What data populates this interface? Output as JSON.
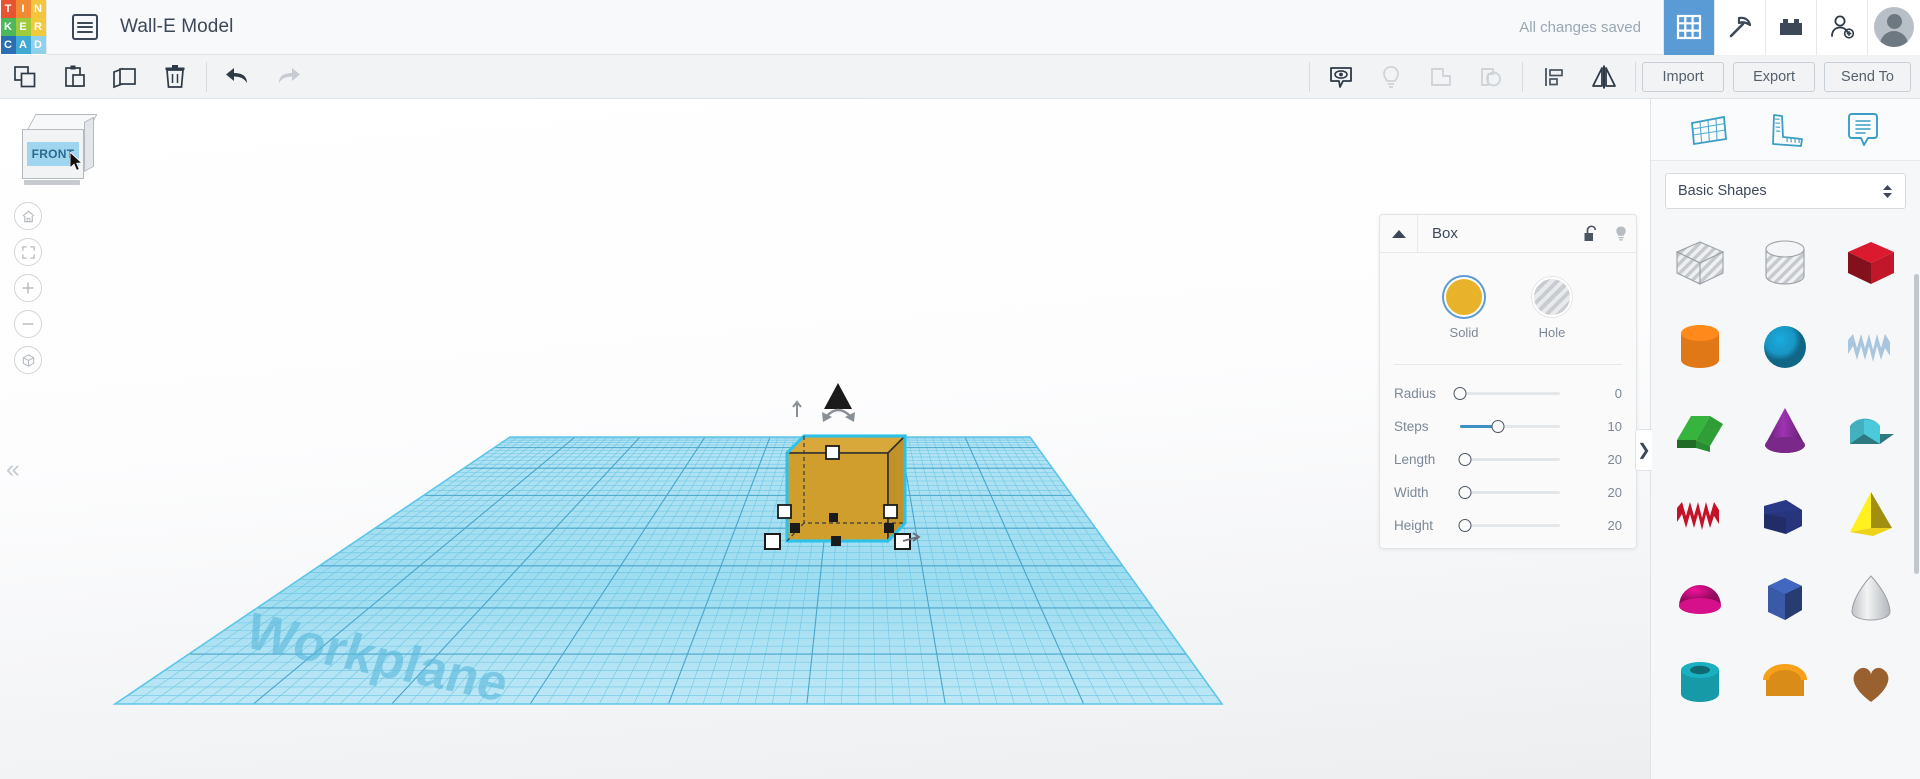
{
  "app": {
    "brand_letters": [
      "T",
      "I",
      "N",
      "K",
      "E",
      "R",
      "C",
      "A",
      "D"
    ],
    "brand_colors": [
      "#e8542f",
      "#f08b33",
      "#f5c53d",
      "#4cb85c",
      "#9dcb3b",
      "#f0c93d",
      "#2b6fb3",
      "#3fa9d4",
      "#8fd0ea"
    ],
    "document_title": "Wall-E Model",
    "save_status": "All changes saved"
  },
  "topbar_icons": [
    {
      "name": "blocks-grid-icon",
      "label": "3D Design",
      "active": true
    },
    {
      "name": "pickaxe-icon",
      "label": "Minecraft",
      "active": false
    },
    {
      "name": "brick-icon",
      "label": "Blocks",
      "active": false
    },
    {
      "name": "invite-person-icon",
      "label": "Invite people",
      "active": false
    }
  ],
  "toolbar": {
    "left_tools": [
      {
        "name": "copy-icon",
        "label": "Copy",
        "enabled": true
      },
      {
        "name": "paste-icon",
        "label": "Paste",
        "enabled": true
      },
      {
        "name": "duplicate-icon",
        "label": "Duplicate",
        "enabled": true
      },
      {
        "name": "delete-icon",
        "label": "Delete",
        "enabled": true
      }
    ],
    "history_tools": [
      {
        "name": "undo-icon",
        "label": "Undo",
        "enabled": true
      },
      {
        "name": "redo-icon",
        "label": "Redo",
        "enabled": false
      }
    ],
    "right_tools": [
      {
        "name": "show-all-icon",
        "label": "Show all",
        "enabled": true
      },
      {
        "name": "lightbulb-icon",
        "label": "Hide",
        "enabled": false
      },
      {
        "name": "group-icon",
        "label": "Group",
        "enabled": false
      },
      {
        "name": "ungroup-icon",
        "label": "Ungroup",
        "enabled": false
      },
      {
        "name": "align-icon",
        "label": "Align",
        "enabled": true
      },
      {
        "name": "mirror-icon",
        "label": "Mirror",
        "enabled": true
      }
    ],
    "import_label": "Import",
    "export_label": "Export",
    "send_to_label": "Send To"
  },
  "viewport": {
    "view_cube_label": "FRONT",
    "workplane_label": "Workplane",
    "nav_buttons": [
      {
        "name": "home-view-button",
        "label": "Home view"
      },
      {
        "name": "fit-to-view-button",
        "label": "Fit all in view"
      },
      {
        "name": "zoom-in-button",
        "label": "Zoom in"
      },
      {
        "name": "zoom-out-button",
        "label": "Zoom out"
      },
      {
        "name": "perspective-toggle-button",
        "label": "Switch to orthographic view"
      }
    ],
    "collapse_label": "«",
    "selected_shape": "Box",
    "grid_color": "#7fd3ee",
    "selection_color": "#2ec6f0",
    "shape_color": "#d69f28"
  },
  "properties": {
    "title": "Box",
    "lock_icon": "unlock-icon",
    "visibility_icon": "lightbulb-icon",
    "collapse_icon": "triangle-up-icon",
    "modes": [
      {
        "name": "solid",
        "label": "Solid",
        "selected": true,
        "color": "#e8b32a"
      },
      {
        "name": "hole",
        "label": "Hole",
        "selected": false,
        "color": "#c9cdd1"
      }
    ],
    "sliders": [
      {
        "label": "Radius",
        "value": "0",
        "pct": 0
      },
      {
        "label": "Steps",
        "value": "10",
        "pct": 38
      },
      {
        "label": "Length",
        "value": "20",
        "pct": 5
      },
      {
        "label": "Width",
        "value": "20",
        "pct": 5
      },
      {
        "label": "Height",
        "value": "20",
        "pct": 5
      }
    ]
  },
  "shapes_panel": {
    "tabs": [
      {
        "name": "workplane-tool-icon",
        "label": "Workplane"
      },
      {
        "name": "ruler-tool-icon",
        "label": "Ruler"
      },
      {
        "name": "notes-tool-icon",
        "label": "Note"
      }
    ],
    "category_selected": "Basic Shapes",
    "expand_label": "❯",
    "items": [
      {
        "name": "box-hole-shape",
        "label": "Box (hole)",
        "color": "#cfd3d7",
        "kind": "hole-box"
      },
      {
        "name": "cylinder-hole-shape",
        "label": "Cylinder (hole)",
        "color": "#cfd3d7",
        "kind": "hole-cylinder"
      },
      {
        "name": "box-shape",
        "label": "Box",
        "color": "#c0172a",
        "kind": "box"
      },
      {
        "name": "cylinder-shape",
        "label": "Cylinder",
        "color": "#e07818",
        "kind": "cylinder"
      },
      {
        "name": "sphere-shape",
        "label": "Sphere",
        "color": "#1896c4",
        "kind": "sphere"
      },
      {
        "name": "scribble-shape",
        "label": "Scribble",
        "color": "#a9c6de",
        "kind": "scribble"
      },
      {
        "name": "roof-shape",
        "label": "Roof",
        "color": "#2f9e36",
        "kind": "roof"
      },
      {
        "name": "cone-shape",
        "label": "Cone",
        "color": "#8b2d9c",
        "kind": "cone"
      },
      {
        "name": "half-cylinder-shape",
        "label": "Half Cylinder",
        "color": "#43b0bf",
        "kind": "halfcyl"
      },
      {
        "name": "text-shape",
        "label": "Text",
        "color": "#c41226",
        "kind": "text"
      },
      {
        "name": "polygon-shape",
        "label": "Polygon",
        "color": "#27357c",
        "kind": "polygon"
      },
      {
        "name": "pyramid-shape",
        "label": "Pyramid",
        "color": "#edd31a",
        "kind": "pyramid"
      },
      {
        "name": "hemisphere-shape",
        "label": "Hemisphere",
        "color": "#d6108a",
        "kind": "hemisphere"
      },
      {
        "name": "hex-prism-shape",
        "label": "Hexagonal Prism",
        "color": "#3a5aa8",
        "kind": "hexprism"
      },
      {
        "name": "paraboloid-shape",
        "label": "Paraboloid",
        "color": "#d9dcdf",
        "kind": "paraboloid"
      },
      {
        "name": "tube-shape",
        "label": "Tube",
        "color": "#169aa8",
        "kind": "tube"
      },
      {
        "name": "round-roof-shape",
        "label": "Round Roof",
        "color": "#d98c17",
        "kind": "roundroof"
      },
      {
        "name": "heart-shape",
        "label": "Heart",
        "color": "#9a6130",
        "kind": "heart"
      }
    ]
  }
}
